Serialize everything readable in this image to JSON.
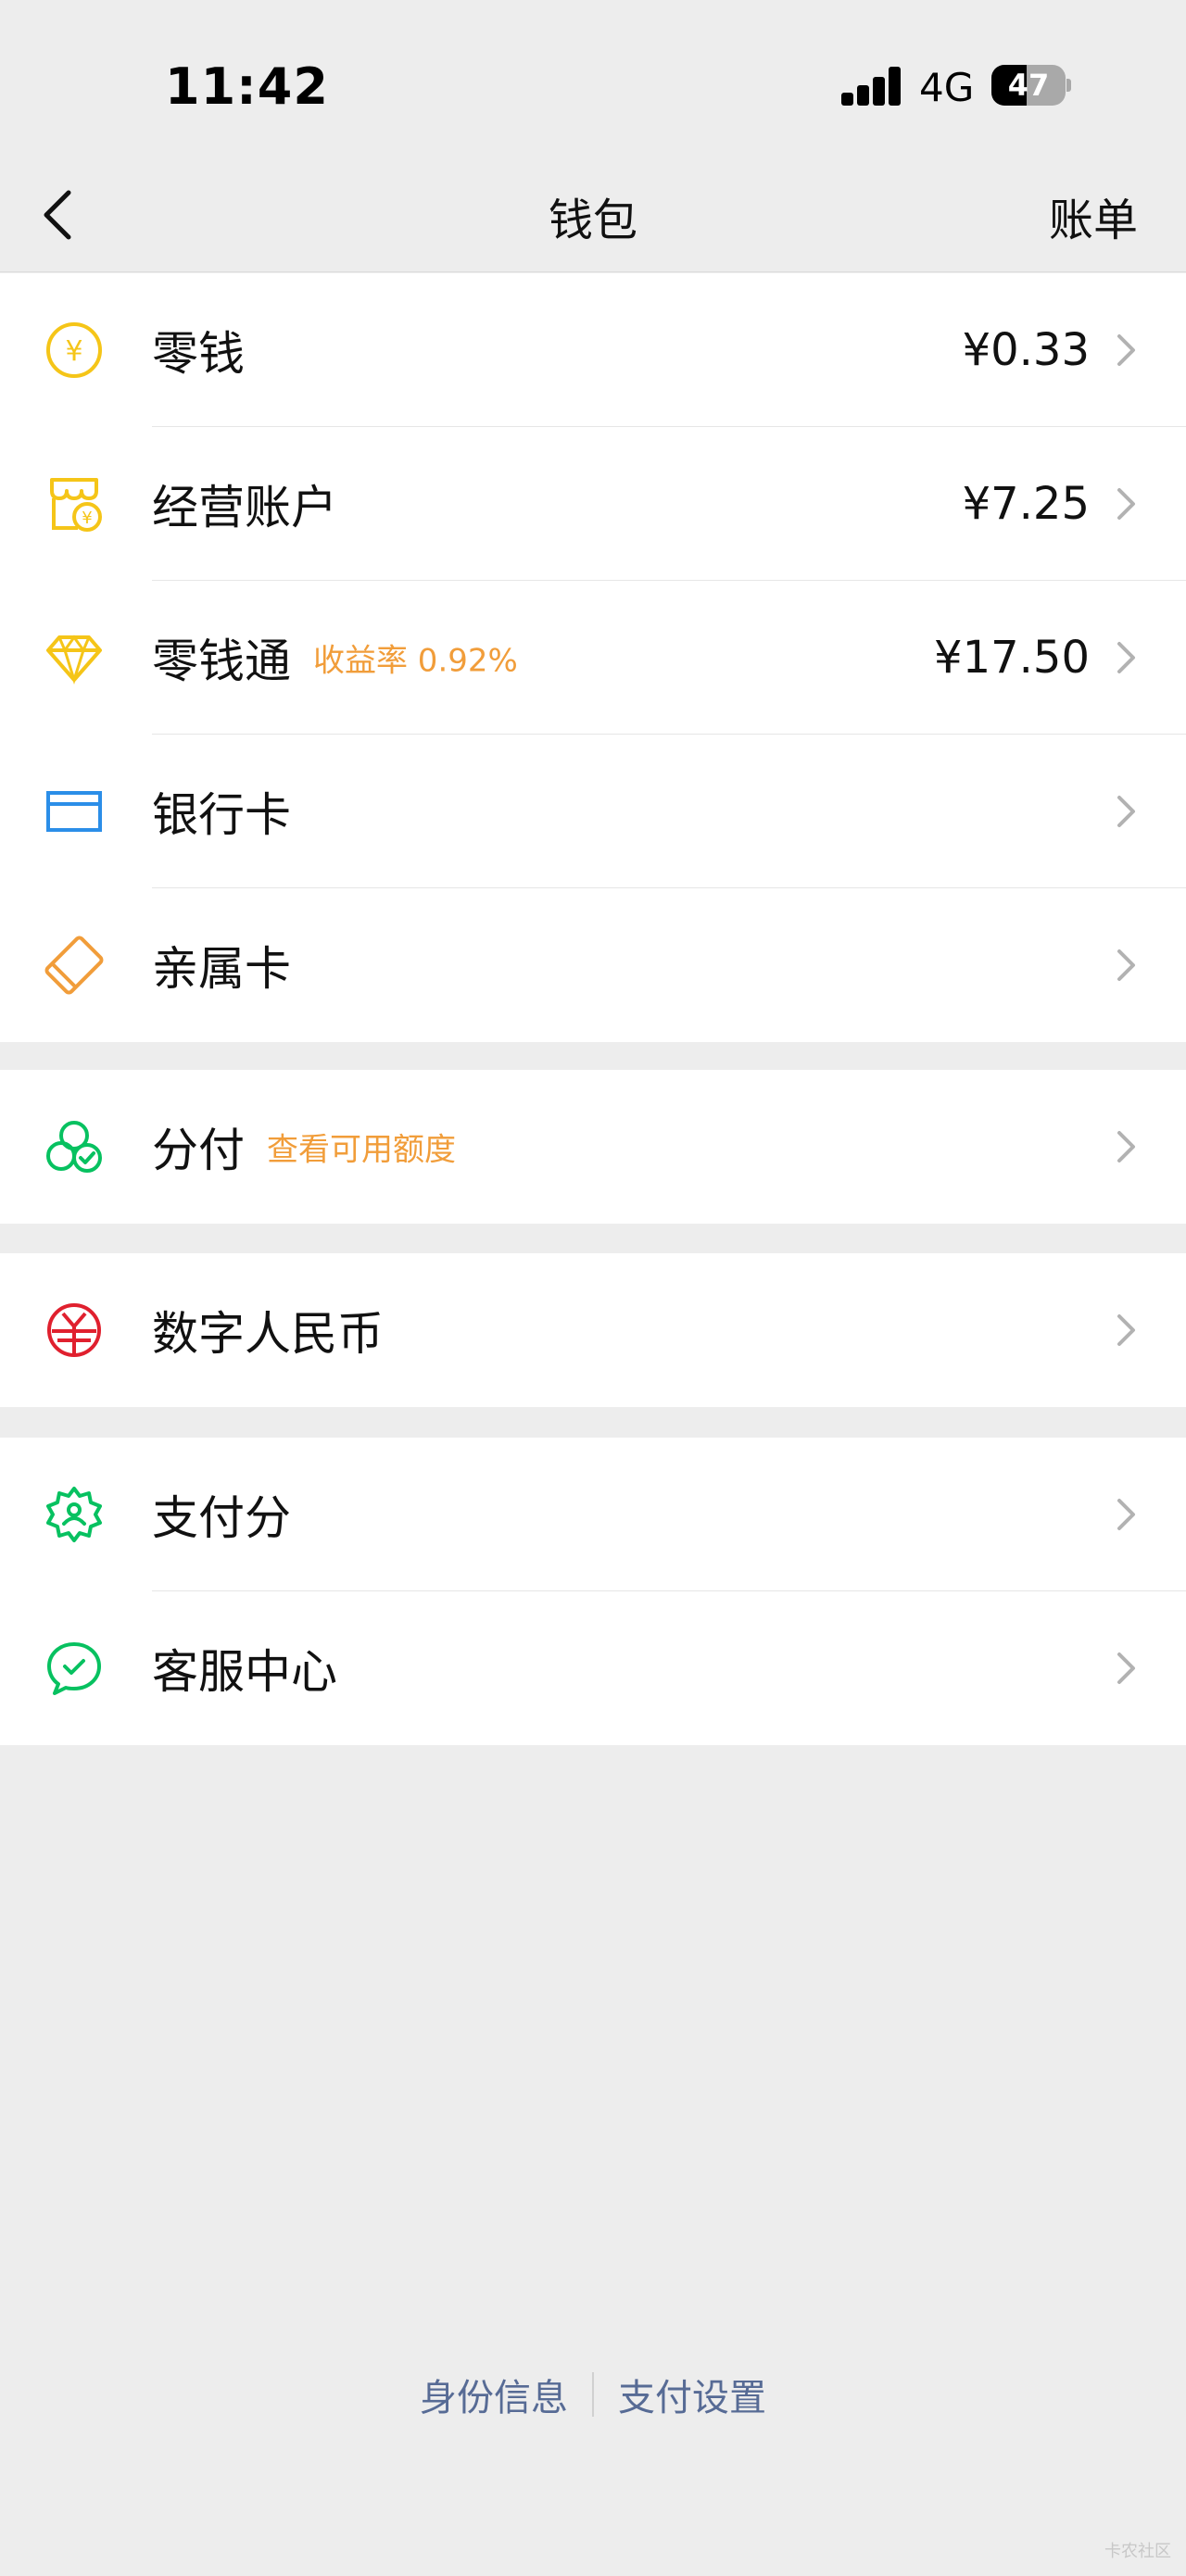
{
  "status_bar": {
    "time": "11:42",
    "network": "4G",
    "battery_level": 47,
    "battery_text": "47"
  },
  "nav": {
    "title": "钱包",
    "right_action": "账单"
  },
  "groups": [
    {
      "items": [
        {
          "label": "零钱",
          "value": "¥0.33",
          "icon": "yuan-coin-icon",
          "color": "#f5c518"
        },
        {
          "label": "经营账户",
          "value": "¥7.25",
          "icon": "store-account-icon",
          "color": "#f5c518"
        },
        {
          "label": "零钱通",
          "sub": "收益率 0.92%",
          "value": "¥17.50",
          "icon": "diamond-icon",
          "color": "#f5c518"
        },
        {
          "label": "银行卡",
          "icon": "bank-card-icon",
          "color": "#2b8ee8"
        },
        {
          "label": "亲属卡",
          "icon": "family-card-icon",
          "color": "#f19d3a"
        }
      ]
    },
    {
      "items": [
        {
          "label": "分付",
          "sub": "查看可用额度",
          "icon": "fenfu-icon",
          "color": "#07c160"
        }
      ]
    },
    {
      "items": [
        {
          "label": "数字人民币",
          "icon": "digital-rmb-icon",
          "color": "#e0202e"
        }
      ]
    },
    {
      "items": [
        {
          "label": "支付分",
          "icon": "pay-score-icon",
          "color": "#07c160"
        },
        {
          "label": "客服中心",
          "icon": "customer-service-icon",
          "color": "#07c160"
        }
      ]
    }
  ],
  "footer": {
    "link1": "身份信息",
    "link2": "支付设置"
  },
  "watermark": "卡农社区"
}
